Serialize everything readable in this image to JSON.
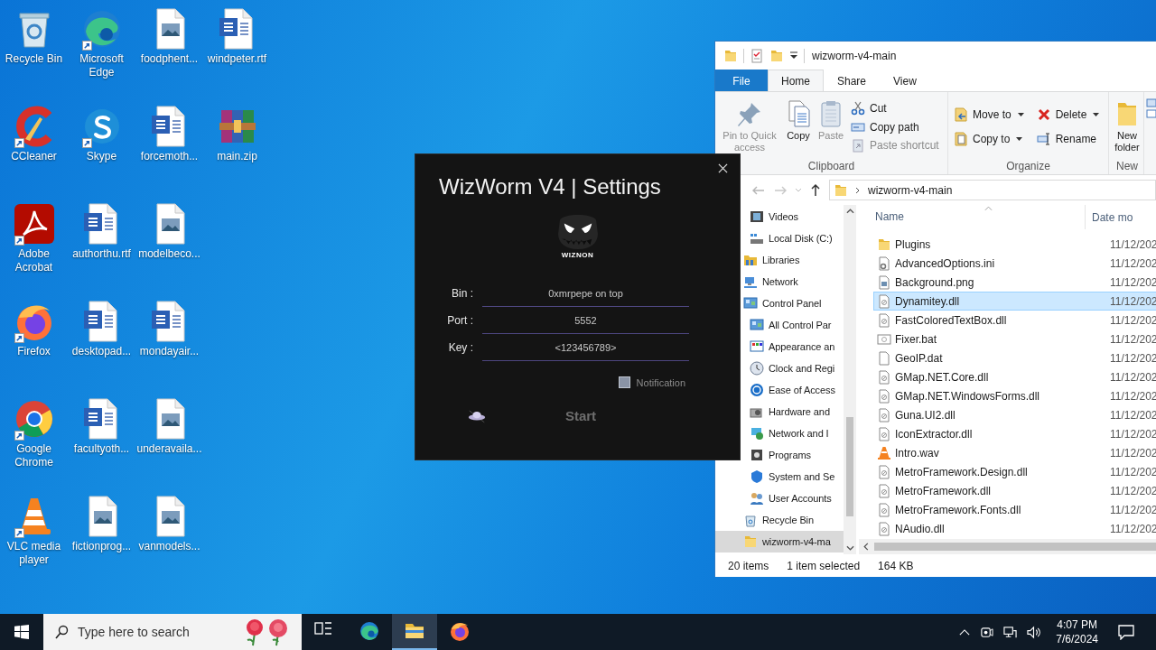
{
  "desktop_icons": [
    {
      "label": "Recycle Bin",
      "kind": "recycle",
      "shortcut": false
    },
    {
      "label": "CCleaner",
      "kind": "ccleaner",
      "shortcut": true
    },
    {
      "label": "Adobe Acrobat",
      "kind": "acrobat",
      "shortcut": true
    },
    {
      "label": "Firefox",
      "kind": "firefox",
      "shortcut": true
    },
    {
      "label": "Google Chrome",
      "kind": "chrome",
      "shortcut": true
    },
    {
      "label": "VLC media player",
      "kind": "vlc",
      "shortcut": true
    },
    {
      "label": "Microsoft Edge",
      "kind": "edge",
      "shortcut": true
    },
    {
      "label": "Skype",
      "kind": "skype",
      "shortcut": true
    },
    {
      "label": "authorthu.rtf",
      "kind": "word",
      "shortcut": false
    },
    {
      "label": "desktopad...",
      "kind": "word",
      "shortcut": false
    },
    {
      "label": "facultyoth...",
      "kind": "word",
      "shortcut": false
    },
    {
      "label": "fictionprog...",
      "kind": "image",
      "shortcut": false
    },
    {
      "label": "foodphent...",
      "kind": "image",
      "shortcut": false
    },
    {
      "label": "forcemoth...",
      "kind": "word",
      "shortcut": false
    },
    {
      "label": "modelbeco...",
      "kind": "image",
      "shortcut": false
    },
    {
      "label": "mondayair...",
      "kind": "word",
      "shortcut": false
    },
    {
      "label": "underavaila...",
      "kind": "image",
      "shortcut": false
    },
    {
      "label": "vanmodels...",
      "kind": "image",
      "shortcut": false
    },
    {
      "label": "windpeter.rtf",
      "kind": "word",
      "shortcut": false
    },
    {
      "label": "main.zip",
      "kind": "zip",
      "shortcut": false
    }
  ],
  "dialog": {
    "title": "WizWorm V4 | Settings",
    "logo_text": "WIZNON",
    "fields": [
      {
        "label": "Bin :",
        "value": "0xmrpepe on top"
      },
      {
        "label": "Port :",
        "value": "5552"
      },
      {
        "label": "Key :",
        "value": "<123456789>"
      }
    ],
    "notification": {
      "label": "Notification",
      "checked": false
    },
    "start_button": "Start"
  },
  "explorer": {
    "title": "wizworm-v4-main",
    "tabs": [
      {
        "label": "File",
        "kind": "file",
        "selected": false
      },
      {
        "label": "Home",
        "kind": "tab",
        "selected": true
      },
      {
        "label": "Share",
        "kind": "tab",
        "selected": false
      },
      {
        "label": "View",
        "kind": "tab",
        "selected": false
      }
    ],
    "ribbon_groups": [
      {
        "label": "Clipboard",
        "commands": [
          {
            "label": "Pin to Quick access",
            "kind": "pin",
            "disabled": true,
            "dropdown": false
          },
          {
            "label": "Copy",
            "kind": "copy",
            "disabled": false,
            "dropdown": false
          },
          {
            "label": "Paste",
            "kind": "paste",
            "disabled": true,
            "dropdown": false
          },
          {
            "label": "Cut",
            "kind": "cut",
            "disabled": false,
            "dropdown": false
          },
          {
            "label": "Copy path",
            "kind": "copypath",
            "disabled": false,
            "dropdown": false
          },
          {
            "label": "Paste shortcut",
            "kind": "pasteshortcut",
            "disabled": true,
            "dropdown": false
          }
        ]
      },
      {
        "label": "Organize",
        "commands": [
          {
            "label": "Move to",
            "kind": "moveto",
            "disabled": false,
            "dropdown": true
          },
          {
            "label": "Copy to",
            "kind": "copyto",
            "disabled": false,
            "dropdown": true
          },
          {
            "label": "Delete",
            "kind": "delete",
            "disabled": false,
            "dropdown": true
          },
          {
            "label": "Rename",
            "kind": "rename",
            "disabled": false,
            "dropdown": false
          }
        ]
      },
      {
        "label": "New",
        "commands": [
          {
            "label": "New folder",
            "kind": "newfolder",
            "disabled": false,
            "dropdown": false
          }
        ]
      }
    ],
    "address": "wizworm-v4-main",
    "nav_partial_children": [
      {
        "label": "Videos",
        "kind": "videos",
        "selected": false
      },
      {
        "label": "Local Disk (C:)",
        "kind": "disk",
        "selected": false
      }
    ],
    "nav_items": [
      {
        "label": "Libraries",
        "kind": "libraries",
        "selected": false
      },
      {
        "label": "Network",
        "kind": "network",
        "selected": false
      },
      {
        "label": "Control Panel",
        "kind": "controlpanel",
        "selected": false,
        "children": [
          {
            "label": "All Control Par",
            "kind": "controlpanel",
            "selected": false
          },
          {
            "label": "Appearance an",
            "kind": "appearance",
            "selected": false
          },
          {
            "label": "Clock and Regi",
            "kind": "clock",
            "selected": false
          },
          {
            "label": "Ease of Access",
            "kind": "ease",
            "selected": false
          },
          {
            "label": "Hardware and",
            "kind": "hardware",
            "selected": false
          },
          {
            "label": "Network and I",
            "kind": "netinternet",
            "selected": false
          },
          {
            "label": "Programs",
            "kind": "programs",
            "selected": false
          },
          {
            "label": "System and Se",
            "kind": "system",
            "selected": false
          },
          {
            "label": "User Accounts",
            "kind": "users",
            "selected": false
          }
        ]
      },
      {
        "label": "Recycle Bin",
        "kind": "recycle",
        "selected": false
      },
      {
        "label": "wizworm-v4-ma",
        "kind": "folder",
        "selected": true
      }
    ],
    "columns": [
      "Name",
      "Date mo"
    ],
    "files": [
      {
        "name": "Plugins",
        "kind": "folder",
        "date": "11/12/202",
        "selected": false
      },
      {
        "name": "AdvancedOptions.ini",
        "kind": "settings",
        "date": "11/12/202",
        "selected": false
      },
      {
        "name": "Background.png",
        "kind": "image",
        "date": "11/12/202",
        "selected": false
      },
      {
        "name": "Dynamitey.dll",
        "kind": "dll",
        "date": "11/12/202",
        "selected": true
      },
      {
        "name": "FastColoredTextBox.dll",
        "kind": "dll",
        "date": "11/12/202",
        "selected": false
      },
      {
        "name": "Fixer.bat",
        "kind": "bat",
        "date": "11/12/202",
        "selected": false
      },
      {
        "name": "GeoIP.dat",
        "kind": "blank",
        "date": "11/12/202",
        "selected": false
      },
      {
        "name": "GMap.NET.Core.dll",
        "kind": "dll",
        "date": "11/12/202",
        "selected": false
      },
      {
        "name": "GMap.NET.WindowsForms.dll",
        "kind": "dll",
        "date": "11/12/202",
        "selected": false
      },
      {
        "name": "Guna.UI2.dll",
        "kind": "dll",
        "date": "11/12/202",
        "selected": false
      },
      {
        "name": "IconExtractor.dll",
        "kind": "dll",
        "date": "11/12/202",
        "selected": false
      },
      {
        "name": "Intro.wav",
        "kind": "media",
        "date": "11/12/202",
        "selected": false
      },
      {
        "name": "MetroFramework.Design.dll",
        "kind": "dll",
        "date": "11/12/202",
        "selected": false
      },
      {
        "name": "MetroFramework.dll",
        "kind": "dll",
        "date": "11/12/202",
        "selected": false
      },
      {
        "name": "MetroFramework.Fonts.dll",
        "kind": "dll",
        "date": "11/12/202",
        "selected": false
      },
      {
        "name": "NAudio.dll",
        "kind": "dll",
        "date": "11/12/202",
        "selected": false
      }
    ],
    "status": [
      "20 items",
      "1 item selected",
      "164 KB"
    ]
  },
  "taskbar": {
    "search_placeholder": "Type here to search",
    "apps": [
      {
        "kind": "taskview",
        "active": false
      },
      {
        "kind": "edge",
        "active": false
      },
      {
        "kind": "explorer",
        "active": true
      },
      {
        "kind": "firefox",
        "active": false
      }
    ],
    "time": "4:07 PM",
    "date": "7/6/2024"
  }
}
